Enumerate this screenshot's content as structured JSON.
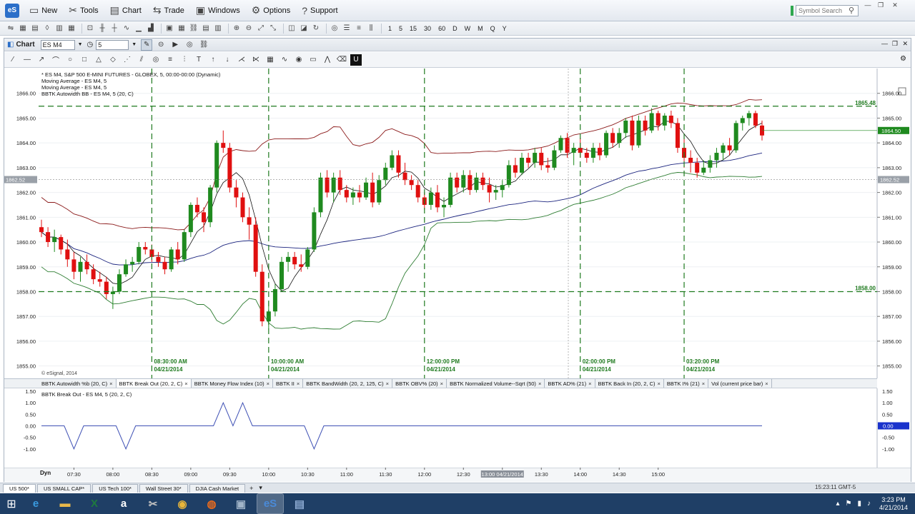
{
  "menu": {
    "logo": "eS",
    "items": [
      {
        "label": "New",
        "icon": "new-icon",
        "glyph": "▭"
      },
      {
        "label": "Tools",
        "icon": "tools-icon",
        "glyph": "✂"
      },
      {
        "label": "Chart",
        "icon": "chart-icon",
        "glyph": "▤"
      },
      {
        "label": "Trade",
        "icon": "trade-icon",
        "glyph": "⇆"
      },
      {
        "label": "Windows",
        "icon": "windows-icon",
        "glyph": "▣"
      },
      {
        "label": "Options",
        "icon": "options-icon",
        "glyph": "⚙"
      },
      {
        "label": "Support",
        "icon": "support-icon",
        "glyph": "?"
      }
    ],
    "search_placeholder": "Symbol Search"
  },
  "toolbar": {
    "intervals": [
      "1",
      "5",
      "15",
      "30",
      "60",
      "D",
      "W",
      "M",
      "Q",
      "Y"
    ]
  },
  "chart_window": {
    "title": "Chart",
    "symbol": "ES M4",
    "interval": "5"
  },
  "chart_info": {
    "line1": "* ES M4, S&P 500 E-MINI FUTURES - GLOBEX, 5, 00:00-00:00 (Dynamic)",
    "line2": "Moving Average - ES M4, 5",
    "line3": "Moving Average - ES M4, 5",
    "line4": "BBTK Autowidth BB - ES M4, 5 (20, C)",
    "copyright": "© eSignal, 2014"
  },
  "chart_data": [
    {
      "type": "candlestick",
      "title": "ES M4, S&P 500 E-MINI FUTURES - GLOBEX, 5, 00:00-00:00 (Dynamic)",
      "ylim": [
        1854.5,
        1867.0
      ],
      "y_ticks": [
        "1866.00",
        "1865.00",
        "1864.00",
        "1863.00",
        "1862.00",
        "1861.00",
        "1860.00",
        "1859.00",
        "1858.00",
        "1857.00",
        "1856.00",
        "1855.00"
      ],
      "x_ticks": [
        "07:30",
        "08:00",
        "08:30",
        "09:00",
        "09:30",
        "10:00",
        "10:30",
        "11:00",
        "11:30",
        "12:00",
        "12:30",
        "13:00 04/21/2014",
        "13:30",
        "14:00",
        "14:30",
        "15:00"
      ],
      "horizontal_lines": [
        {
          "label": "1865.48",
          "value": 1865.48
        },
        {
          "label": "1858.00",
          "value": 1858.0
        }
      ],
      "vertical_markers": [
        {
          "time": "08:30:00 AM",
          "date": "04/21/2014"
        },
        {
          "time": "10:00:00 AM",
          "date": "04/21/2014"
        },
        {
          "time": "12:00:00 PM",
          "date": "04/21/2014"
        },
        {
          "time": "02:00:00 PM",
          "date": "04/21/2014"
        },
        {
          "time": "03:20:00 PM",
          "date": "04/21/2014"
        }
      ],
      "last_price": "1864.50",
      "cursor_price": "1862.52",
      "colors": {
        "up": "#1f8a1f",
        "down": "#e01010",
        "upper_band": "#8b1a1a",
        "lower_band": "#2e7d32",
        "ma_long": "#1a237e",
        "ma_short": "#111111",
        "price_tag": "#1f8a1f"
      },
      "candles": [
        [
          1860.6,
          1860.9,
          1860.2,
          1860.4
        ],
        [
          1860.4,
          1860.6,
          1859.8,
          1860.0
        ],
        [
          1860.0,
          1860.5,
          1859.6,
          1860.2
        ],
        [
          1860.2,
          1860.3,
          1859.5,
          1859.7
        ],
        [
          1859.7,
          1860.1,
          1859.0,
          1859.3
        ],
        [
          1859.3,
          1859.6,
          1858.5,
          1858.8
        ],
        [
          1858.8,
          1859.4,
          1858.4,
          1859.2
        ],
        [
          1859.2,
          1859.5,
          1858.7,
          1858.9
        ],
        [
          1858.9,
          1859.1,
          1858.3,
          1858.5
        ],
        [
          1858.5,
          1858.8,
          1858.2,
          1858.4
        ],
        [
          1858.4,
          1858.6,
          1857.7,
          1857.9
        ],
        [
          1857.9,
          1858.2,
          1857.3,
          1858.0
        ],
        [
          1858.0,
          1858.9,
          1857.9,
          1858.7
        ],
        [
          1858.7,
          1859.3,
          1858.6,
          1859.1
        ],
        [
          1859.1,
          1859.4,
          1858.8,
          1859.2
        ],
        [
          1859.2,
          1860.0,
          1859.1,
          1859.8
        ],
        [
          1859.8,
          1860.0,
          1859.5,
          1859.7
        ],
        [
          1859.7,
          1859.9,
          1859.2,
          1859.4
        ],
        [
          1859.4,
          1859.6,
          1859.0,
          1859.2
        ],
        [
          1859.2,
          1859.4,
          1858.7,
          1858.9
        ],
        [
          1858.9,
          1859.8,
          1858.8,
          1859.7
        ],
        [
          1859.7,
          1860.0,
          1859.1,
          1859.3
        ],
        [
          1859.3,
          1860.5,
          1859.2,
          1860.4
        ],
        [
          1860.4,
          1861.6,
          1860.2,
          1861.5
        ],
        [
          1861.5,
          1861.8,
          1861.0,
          1861.2
        ],
        [
          1861.2,
          1861.4,
          1860.4,
          1860.8
        ],
        [
          1860.8,
          1862.3,
          1860.6,
          1862.2
        ],
        [
          1862.2,
          1864.1,
          1862.0,
          1864.0
        ],
        [
          1864.0,
          1864.5,
          1863.6,
          1863.8
        ],
        [
          1863.8,
          1864.0,
          1862.0,
          1862.2
        ],
        [
          1862.2,
          1862.5,
          1861.4,
          1861.8
        ],
        [
          1861.8,
          1862.0,
          1860.8,
          1861.0
        ],
        [
          1861.0,
          1861.4,
          1860.1,
          1860.7
        ],
        [
          1860.7,
          1861.0,
          1858.6,
          1858.8
        ],
        [
          1858.8,
          1859.1,
          1856.6,
          1856.8
        ],
        [
          1856.8,
          1857.6,
          1856.5,
          1857.2
        ],
        [
          1857.2,
          1858.3,
          1857.0,
          1858.1
        ],
        [
          1858.1,
          1859.4,
          1858.0,
          1859.2
        ],
        [
          1859.2,
          1859.6,
          1858.8,
          1859.4
        ],
        [
          1859.4,
          1859.6,
          1858.9,
          1859.1
        ],
        [
          1859.1,
          1859.5,
          1858.8,
          1859.0
        ],
        [
          1859.0,
          1859.8,
          1858.9,
          1859.7
        ],
        [
          1859.7,
          1861.4,
          1859.6,
          1861.2
        ],
        [
          1861.2,
          1862.8,
          1861.0,
          1862.6
        ],
        [
          1862.6,
          1862.9,
          1861.8,
          1862.0
        ],
        [
          1862.0,
          1862.8,
          1861.6,
          1862.6
        ],
        [
          1862.6,
          1862.9,
          1861.9,
          1862.1
        ],
        [
          1862.1,
          1862.3,
          1861.6,
          1861.8
        ],
        [
          1861.8,
          1862.2,
          1861.5,
          1862.0
        ],
        [
          1862.0,
          1862.3,
          1861.6,
          1861.8
        ],
        [
          1861.8,
          1862.6,
          1861.7,
          1862.4
        ],
        [
          1862.4,
          1862.8,
          1861.4,
          1861.6
        ],
        [
          1861.6,
          1862.7,
          1861.5,
          1862.5
        ],
        [
          1862.5,
          1863.2,
          1862.3,
          1863.0
        ],
        [
          1863.0,
          1863.7,
          1862.9,
          1863.5
        ],
        [
          1863.5,
          1863.7,
          1862.6,
          1862.8
        ],
        [
          1862.8,
          1863.2,
          1862.3,
          1862.5
        ],
        [
          1862.5,
          1862.7,
          1862.1,
          1862.3
        ],
        [
          1862.3,
          1862.5,
          1861.6,
          1861.8
        ],
        [
          1861.8,
          1862.0,
          1861.3,
          1861.5
        ],
        [
          1861.5,
          1862.2,
          1861.3,
          1862.0
        ],
        [
          1862.0,
          1862.3,
          1861.2,
          1861.4
        ],
        [
          1861.4,
          1861.8,
          1861.0,
          1861.5
        ],
        [
          1861.5,
          1862.8,
          1861.4,
          1862.6
        ],
        [
          1862.6,
          1862.8,
          1862.0,
          1862.2
        ],
        [
          1862.2,
          1862.9,
          1862.0,
          1862.7
        ],
        [
          1862.7,
          1862.9,
          1861.9,
          1862.1
        ],
        [
          1862.1,
          1862.8,
          1862.0,
          1862.6
        ],
        [
          1862.6,
          1862.8,
          1862.1,
          1862.3
        ],
        [
          1862.3,
          1862.6,
          1861.6,
          1862.0
        ],
        [
          1862.0,
          1862.3,
          1861.7,
          1862.1
        ],
        [
          1862.1,
          1862.5,
          1861.8,
          1862.3
        ],
        [
          1862.3,
          1863.3,
          1862.2,
          1863.1
        ],
        [
          1863.1,
          1863.4,
          1862.6,
          1862.8
        ],
        [
          1862.8,
          1863.6,
          1862.7,
          1863.4
        ],
        [
          1863.4,
          1863.6,
          1863.0,
          1863.2
        ],
        [
          1863.2,
          1863.8,
          1863.0,
          1863.6
        ],
        [
          1863.6,
          1863.8,
          1862.9,
          1863.1
        ],
        [
          1863.1,
          1863.4,
          1862.8,
          1863.0
        ],
        [
          1863.0,
          1863.9,
          1862.9,
          1863.7
        ],
        [
          1863.7,
          1864.3,
          1863.6,
          1864.2
        ],
        [
          1864.2,
          1864.4,
          1863.4,
          1863.6
        ],
        [
          1863.6,
          1864.0,
          1863.1,
          1863.8
        ],
        [
          1863.8,
          1864.2,
          1863.4,
          1863.6
        ],
        [
          1863.6,
          1863.8,
          1863.2,
          1863.4
        ],
        [
          1863.4,
          1864.0,
          1863.2,
          1863.8
        ],
        [
          1863.8,
          1864.0,
          1863.3,
          1863.5
        ],
        [
          1863.5,
          1864.5,
          1863.4,
          1864.4
        ],
        [
          1864.4,
          1864.6,
          1863.8,
          1864.0
        ],
        [
          1864.0,
          1864.6,
          1863.8,
          1864.4
        ],
        [
          1864.4,
          1865.0,
          1864.2,
          1864.9
        ],
        [
          1864.9,
          1865.1,
          1863.7,
          1863.9
        ],
        [
          1863.9,
          1865.1,
          1863.8,
          1864.9
        ],
        [
          1864.9,
          1865.1,
          1864.3,
          1864.5
        ],
        [
          1864.5,
          1865.4,
          1864.4,
          1865.2
        ],
        [
          1865.2,
          1865.3,
          1864.5,
          1864.7
        ],
        [
          1864.7,
          1865.2,
          1864.5,
          1865.1
        ],
        [
          1865.1,
          1865.3,
          1864.6,
          1864.8
        ],
        [
          1864.8,
          1865.0,
          1863.6,
          1863.8
        ],
        [
          1863.8,
          1864.2,
          1863.0,
          1863.4
        ],
        [
          1863.4,
          1863.7,
          1862.8,
          1863.2
        ],
        [
          1863.2,
          1863.4,
          1862.6,
          1862.8
        ],
        [
          1862.8,
          1863.3,
          1862.7,
          1863.0
        ],
        [
          1863.0,
          1863.5,
          1862.8,
          1863.3
        ],
        [
          1863.3,
          1863.8,
          1863.0,
          1863.6
        ],
        [
          1863.6,
          1864.0,
          1863.3,
          1863.9
        ],
        [
          1863.9,
          1864.2,
          1863.5,
          1863.7
        ],
        [
          1863.7,
          1864.9,
          1863.6,
          1864.8
        ],
        [
          1864.8,
          1865.1,
          1864.5,
          1865.0
        ],
        [
          1865.0,
          1865.3,
          1864.7,
          1865.2
        ],
        [
          1865.2,
          1865.3,
          1864.6,
          1864.7
        ],
        [
          1864.7,
          1864.9,
          1864.1,
          1864.3
        ]
      ]
    },
    {
      "type": "line",
      "title": "BBTK Break Out - ES M4, 5 (20, 2, C)",
      "ylim": [
        -1.5,
        1.5
      ],
      "y_ticks": [
        "1.50",
        "1.00",
        "0.50",
        "0.00",
        "-0.50",
        "-1.00"
      ],
      "last_value": "0.00",
      "series": [
        {
          "name": "BBTK Break Out",
          "spikes": [
            {
              "bar": 5,
              "value": -1
            },
            {
              "bar": 13,
              "value": -1
            },
            {
              "bar": 28,
              "value": 1
            },
            {
              "bar": 31,
              "value": 1
            },
            {
              "bar": 42,
              "value": -1
            }
          ]
        }
      ]
    }
  ],
  "study_tabs": [
    "BBTK Autowidth %b (20, C)",
    "BBTK Break Out (20, 2, C)",
    "BBTK Money Flow Index (10)",
    "BBTK II",
    "BBTK BandWidth (20, 2, 125, C)",
    "BBTK OBV% (20)",
    "BBTK Normalized Volume--Sqrt (50)",
    "BBTK AD% (21)",
    "BBTK Back In (20, 2, C)",
    "BBTK I% (21)",
    "Vol (current price bar)"
  ],
  "axis": {
    "dyn_label": "Dyn"
  },
  "workspace_tabs": [
    "US 500*",
    "US SMALL CAP*",
    "US Tech 100*",
    "Wall Street 30*",
    "DJIA Cash Market"
  ],
  "status": {
    "clock": "15:23:11 GMT-5"
  },
  "taskbar": {
    "apps": [
      {
        "name": "internet-explorer-icon",
        "glyph": "e",
        "color": "#3a9be0"
      },
      {
        "name": "file-explorer-icon",
        "glyph": "▬",
        "color": "#e8b84a"
      },
      {
        "name": "excel-icon",
        "glyph": "X",
        "color": "#1e7b3e"
      },
      {
        "name": "amazon-icon",
        "glyph": "a",
        "color": "#ffffff"
      },
      {
        "name": "tool-icon",
        "glyph": "✂",
        "color": "#c0c0c0"
      },
      {
        "name": "chrome-icon",
        "glyph": "◉",
        "color": "#e8b53a"
      },
      {
        "name": "firefox-icon",
        "glyph": "◍",
        "color": "#e66a1e"
      },
      {
        "name": "monitor-icon",
        "glyph": "▣",
        "color": "#a0b4c8"
      },
      {
        "name": "esignal-icon",
        "glyph": "eS",
        "color": "#4a8ad8"
      },
      {
        "name": "floppy-icon",
        "glyph": "▤",
        "color": "#8aa8d0"
      }
    ],
    "time": "3:23 PM",
    "date": "4/21/2014"
  }
}
